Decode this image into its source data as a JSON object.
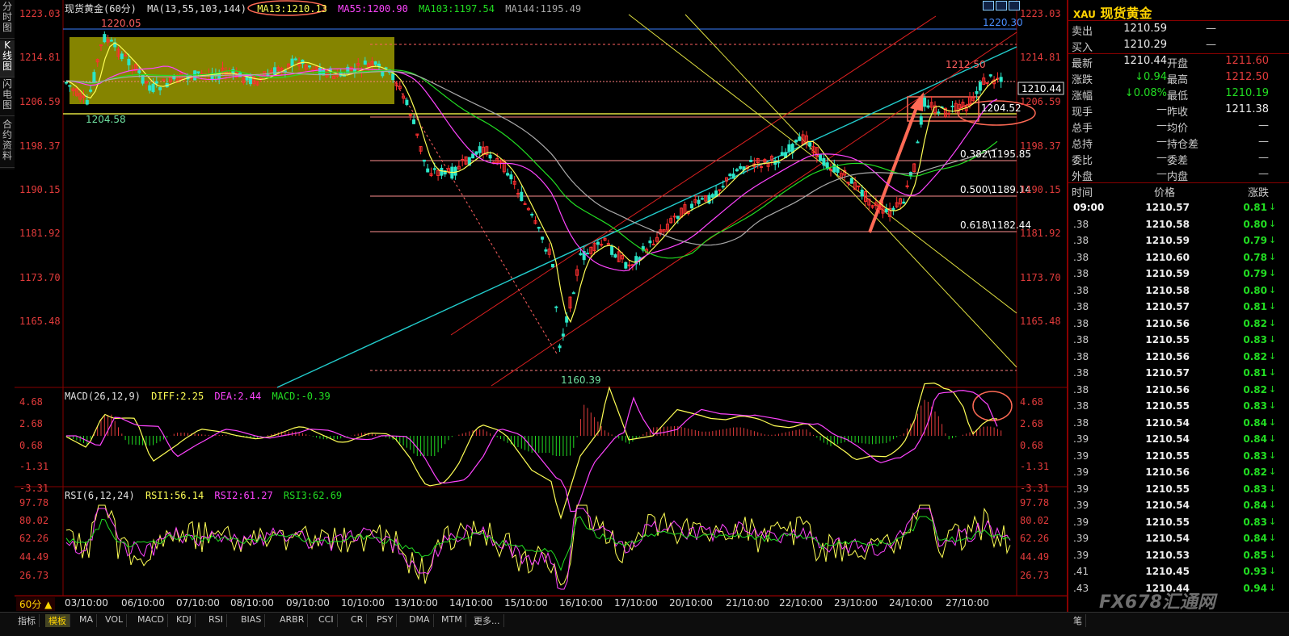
{
  "left_tabs": [
    {
      "label": "分时图"
    },
    {
      "label": "K线图"
    },
    {
      "label": "闪电图"
    },
    {
      "label": "合约资料"
    }
  ],
  "chart": {
    "symbol_label": "现货黄金(60分)",
    "indicator_label": "MA(13,55,103,144)",
    "ma13": "MA13:1210.13",
    "ma55": "MA55:1200.90",
    "ma103": "MA103:1197.54",
    "ma144": "MA144:1195.49",
    "y_axis_left": [
      "1223.03",
      "1214.81",
      "1206.59",
      "1198.37",
      "1190.15",
      "1181.92",
      "1173.70",
      "1165.48"
    ],
    "y_axis_right": [
      "1223.03",
      "1214.81",
      "1206.59",
      "1198.37",
      "1190.15",
      "1181.92",
      "1173.70",
      "1165.48"
    ],
    "price_tag": "1210.44",
    "annotations": {
      "high_box": "1220.05",
      "low_box": "1204.58",
      "hline": "1220.30",
      "recent_high": "1212.50",
      "box_level": "1204.52",
      "fib382": "0.382\\1195.85",
      "fib500": "0.500\\1189.14",
      "fib618": "0.618\\1182.44",
      "low": "1160.39"
    },
    "dates": [
      "03/10:00",
      "06/10:00",
      "07/10:00",
      "08/10:00",
      "09/10:00",
      "10/10:00",
      "13/10:00",
      "14/10:00",
      "15/10:00",
      "16/10:00",
      "17/10:00",
      "20/10:00",
      "21/10:00",
      "22/10:00",
      "23/10:00",
      "24/10:00",
      "27/10:00"
    ],
    "period_button": "60分 ▲"
  },
  "macd": {
    "label": "MACD(26,12,9)",
    "diff": "DIFF:2.25",
    "dea": "DEA:2.44",
    "macd": "MACD:-0.39",
    "y_axis": [
      "4.68",
      "2.68",
      "0.68",
      "-1.31",
      "-3.31"
    ]
  },
  "rsi": {
    "label": "RSI(6,12,24)",
    "rsi1": "RSI1:56.14",
    "rsi2": "RSI2:61.27",
    "rsi3": "RSI3:62.69",
    "y_axis": [
      "97.78",
      "80.02",
      "62.26",
      "44.49",
      "26.73"
    ]
  },
  "bottom_tabs": [
    "指标",
    "模板",
    "MA",
    "VOL",
    "MACD",
    "KDJ",
    "RSI",
    "BIAS",
    "ARBR",
    "CCI",
    "CR",
    "PSY",
    "DMA",
    "MTM",
    "更多..."
  ],
  "side": {
    "code": "XAU",
    "name": "现货黄金",
    "sell_label": "卖出",
    "sell_value": "1210.59",
    "sell_vol": "—",
    "buy_label": "买入",
    "buy_value": "1210.29",
    "buy_vol": "—",
    "rows": [
      {
        "k1": "最新",
        "v1": "1210.44",
        "k2": "开盘",
        "v2": "1211.60"
      },
      {
        "k1": "涨跌",
        "v1": "↓0.94",
        "k2": "最高",
        "v2": "1212.50"
      },
      {
        "k1": "涨幅",
        "v1": "↓0.08%",
        "k2": "最低",
        "v2": "1210.19"
      },
      {
        "k1": "现手",
        "v1": "—",
        "k2": "昨收",
        "v2": "1211.38"
      },
      {
        "k1": "总手",
        "v1": "—",
        "k2": "均价",
        "v2": "—"
      },
      {
        "k1": "总持",
        "v1": "—",
        "k2": "持仓差",
        "v2": "—"
      },
      {
        "k1": "委比",
        "v1": "—",
        "k2": "委差",
        "v2": "—"
      },
      {
        "k1": "外盘",
        "v1": "—",
        "k2": "内盘",
        "v2": "—"
      }
    ],
    "tick_header": {
      "time": "时间",
      "price": "价格",
      "change": "涨跌"
    },
    "ticks": [
      {
        "t": "09:00",
        "p": "1210.57",
        "c": "0.81"
      },
      {
        "t": ".38",
        "p": "1210.58",
        "c": "0.80"
      },
      {
        "t": ".38",
        "p": "1210.59",
        "c": "0.79"
      },
      {
        "t": ".38",
        "p": "1210.60",
        "c": "0.78"
      },
      {
        "t": ".38",
        "p": "1210.59",
        "c": "0.79"
      },
      {
        "t": ".38",
        "p": "1210.58",
        "c": "0.80"
      },
      {
        "t": ".38",
        "p": "1210.57",
        "c": "0.81"
      },
      {
        "t": ".38",
        "p": "1210.56",
        "c": "0.82"
      },
      {
        "t": ".38",
        "p": "1210.55",
        "c": "0.83"
      },
      {
        "t": ".38",
        "p": "1210.56",
        "c": "0.82"
      },
      {
        "t": ".38",
        "p": "1210.57",
        "c": "0.81"
      },
      {
        "t": ".38",
        "p": "1210.56",
        "c": "0.82"
      },
      {
        "t": ".38",
        "p": "1210.55",
        "c": "0.83"
      },
      {
        "t": ".38",
        "p": "1210.54",
        "c": "0.84"
      },
      {
        "t": ".39",
        "p": "1210.54",
        "c": "0.84"
      },
      {
        "t": ".39",
        "p": "1210.55",
        "c": "0.83"
      },
      {
        "t": ".39",
        "p": "1210.56",
        "c": "0.82"
      },
      {
        "t": ".39",
        "p": "1210.55",
        "c": "0.83"
      },
      {
        "t": ".39",
        "p": "1210.54",
        "c": "0.84"
      },
      {
        "t": ".39",
        "p": "1210.55",
        "c": "0.83"
      },
      {
        "t": ".39",
        "p": "1210.54",
        "c": "0.84"
      },
      {
        "t": ".39",
        "p": "1210.53",
        "c": "0.85"
      },
      {
        "t": ".41",
        "p": "1210.45",
        "c": "0.93"
      },
      {
        "t": ".43",
        "p": "1210.44",
        "c": "0.94"
      }
    ],
    "watermark": "FX678汇通网",
    "bottom_tab": "笔"
  },
  "colors": {
    "up": "#e23b3b",
    "down": "#22dd22",
    "ma13": "#ffff55",
    "ma55": "#ff44ff",
    "ma103": "#22dd22",
    "ma144": "#aaaaaa"
  }
}
